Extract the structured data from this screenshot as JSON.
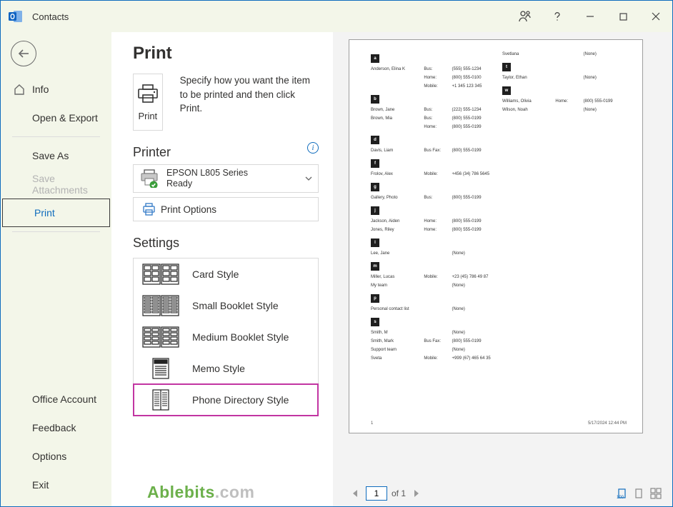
{
  "window_title": "Contacts",
  "sidebar": {
    "info": "Info",
    "open_export": "Open & Export",
    "save_as": "Save As",
    "save_attach": "Save Attachments",
    "print": "Print",
    "office_account": "Office Account",
    "feedback": "Feedback",
    "options": "Options",
    "exit": "Exit"
  },
  "main": {
    "heading": "Print",
    "print_btn": "Print",
    "instruction": "Specify how you want the item to be printed and then click Print.",
    "printer_heading": "Printer",
    "printer_name": "EPSON L805 Series",
    "printer_status": "Ready",
    "print_options": "Print Options",
    "settings_heading": "Settings",
    "styles": [
      "Card Style",
      "Small Booklet Style",
      "Medium Booklet Style",
      "Memo Style",
      "Phone Directory Style"
    ]
  },
  "nav": {
    "page_value": "1",
    "of_label": "of 1"
  },
  "watermark": {
    "a": "Ablebits",
    "b": ".com"
  },
  "page": {
    "footer_page": "1",
    "footer_time": "5/17/2024  12:44 PM",
    "left": [
      {
        "letter": "a"
      },
      {
        "name": "Anderson, Elina K",
        "rows": [
          [
            "Bus:",
            "(555) 555-1234"
          ],
          [
            "Home:",
            "(800) 555-0100"
          ],
          [
            "Mobile:",
            "+1 345 123 345"
          ]
        ]
      },
      {
        "letter": "b"
      },
      {
        "name": "Brown, Jane",
        "rows": [
          [
            "Bus:",
            "(222) 555-1234"
          ]
        ]
      },
      {
        "name": "Brown, Mia",
        "rows": [
          [
            "Bus:",
            "(800) 555-0199"
          ],
          [
            "Home:",
            "(800) 555-0199"
          ]
        ]
      },
      {
        "letter": "d"
      },
      {
        "name": "Davis, Liam",
        "rows": [
          [
            "Bus Fax:",
            "(800) 555-0199"
          ]
        ]
      },
      {
        "letter": "f"
      },
      {
        "name": "Frolov, Alex",
        "rows": [
          [
            "Mobile:",
            "+456 (34) 786 5645"
          ]
        ]
      },
      {
        "letter": "g"
      },
      {
        "name": "Gallery, Photo",
        "rows": [
          [
            "Bus:",
            "(800) 555-0199"
          ]
        ]
      },
      {
        "letter": "j"
      },
      {
        "name": "Jackson, Aiden",
        "rows": [
          [
            "Home:",
            "(800) 555-0199"
          ]
        ]
      },
      {
        "name": "Jones, Riley",
        "rows": [
          [
            "Home:",
            "(800) 555-0199"
          ]
        ]
      },
      {
        "letter": "l"
      },
      {
        "name": "Lee, Jane",
        "rows": [
          [
            "",
            "(None)"
          ]
        ]
      },
      {
        "letter": "m"
      },
      {
        "name": "Miller, Lucas",
        "rows": [
          [
            "Mobile:",
            "+23 (45) 786 49 87"
          ]
        ]
      },
      {
        "name": "My team",
        "rows": [
          [
            "",
            "(None)"
          ]
        ]
      },
      {
        "letter": "p"
      },
      {
        "name": "Personal contact list",
        "rows": [
          [
            "",
            "(None)"
          ]
        ]
      },
      {
        "letter": "s"
      },
      {
        "name": "Smith, M",
        "rows": [
          [
            "",
            "(None)"
          ]
        ]
      },
      {
        "name": "Smith, Mark",
        "rows": [
          [
            "Bus Fax:",
            "(800) 555-0199"
          ]
        ]
      },
      {
        "name": "Support team",
        "rows": [
          [
            "",
            "(None)"
          ]
        ]
      },
      {
        "name": "Sveta",
        "rows": [
          [
            "Mobile:",
            "+999 (67) 465 64 35"
          ]
        ]
      }
    ],
    "right": [
      {
        "name": "Svetlana",
        "rows": [
          [
            "",
            "(None)"
          ]
        ]
      },
      {
        "letter": "t"
      },
      {
        "name": "Taylor, Ethan",
        "rows": [
          [
            "",
            "(None)"
          ]
        ]
      },
      {
        "letter": "w"
      },
      {
        "name": "Williams, Olivia",
        "rows": [
          [
            "Home:",
            "(800) 555-0199"
          ]
        ]
      },
      {
        "name": "Wilson, Noah",
        "rows": [
          [
            "",
            "(None)"
          ]
        ]
      }
    ]
  }
}
